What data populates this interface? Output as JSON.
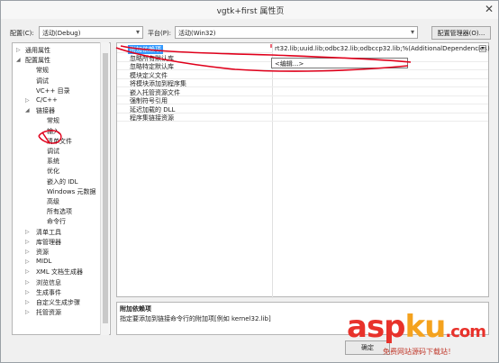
{
  "window": {
    "title": "vgtk+first 属性页",
    "close": "✕"
  },
  "config": {
    "config_label": "配置(C):",
    "config_value": "活动(Debug)",
    "platform_label": "平台(P):",
    "platform_value": "活动(Win32)",
    "manager_label": "配置管理器(O)..."
  },
  "tree": {
    "items": [
      {
        "label": "通用属性",
        "twisty": "▷"
      },
      {
        "label": "配置属性",
        "twisty": "◢"
      },
      {
        "label": "常规",
        "twisty": ""
      },
      {
        "label": "调试",
        "twisty": ""
      },
      {
        "label": "VC++ 目录",
        "twisty": ""
      },
      {
        "label": "C/C++",
        "twisty": "▷"
      },
      {
        "label": "链接器",
        "twisty": "◢"
      },
      {
        "label": "常规",
        "twisty": ""
      },
      {
        "label": "输入",
        "twisty": ""
      },
      {
        "label": "清单文件",
        "twisty": ""
      },
      {
        "label": "调试",
        "twisty": ""
      },
      {
        "label": "系统",
        "twisty": ""
      },
      {
        "label": "优化",
        "twisty": ""
      },
      {
        "label": "嵌入的 IDL",
        "twisty": ""
      },
      {
        "label": "Windows 元数据",
        "twisty": ""
      },
      {
        "label": "高级",
        "twisty": ""
      },
      {
        "label": "所有选项",
        "twisty": ""
      },
      {
        "label": "命令行",
        "twisty": ""
      },
      {
        "label": "清单工具",
        "twisty": "▷"
      },
      {
        "label": "库管理器",
        "twisty": "▷"
      },
      {
        "label": "资源",
        "twisty": "▷"
      },
      {
        "label": "MIDL",
        "twisty": "▷"
      },
      {
        "label": "XML 文档生成器",
        "twisty": "▷"
      },
      {
        "label": "浏览信息",
        "twisty": "▷"
      },
      {
        "label": "生成事件",
        "twisty": "▷"
      },
      {
        "label": "自定义生成步骤",
        "twisty": "▷"
      },
      {
        "label": "托管资源",
        "twisty": "▷"
      }
    ]
  },
  "grid": {
    "rows": [
      {
        "name": "附加依赖项",
        "value": "rt32.lib;uuid.lib;odbc32.lib;odbccp32.lib;%(AdditionalDependencies)"
      },
      {
        "name": "忽略所有默认库",
        "value": ""
      },
      {
        "name": "忽略特定默认库",
        "value": ""
      },
      {
        "name": "模块定义文件",
        "value": ""
      },
      {
        "name": "将模块添加到程序集",
        "value": ""
      },
      {
        "name": "嵌入托管资源文件",
        "value": ""
      },
      {
        "name": "强制符号引用",
        "value": ""
      },
      {
        "name": "延迟加载的 DLL",
        "value": ""
      },
      {
        "name": "程序集链接资源",
        "value": ""
      }
    ],
    "dropdown_arrow": "▾",
    "popup_item": "<编辑...>"
  },
  "description": {
    "title": "附加依赖项",
    "text": "指定要添加到链接命令行的附加项[例如 kernel32.lib]"
  },
  "buttons": {
    "ok": "确定"
  },
  "watermark": {
    "brand_a": "asp",
    "brand_b": "ku",
    "brand_c": ".com",
    "tagline": "免费网站源码下载站！"
  },
  "colors": {
    "selection": "#3399ff",
    "annotation": "#e0001b",
    "brand_red": "#e8322b",
    "brand_orange": "#f4a21e"
  }
}
